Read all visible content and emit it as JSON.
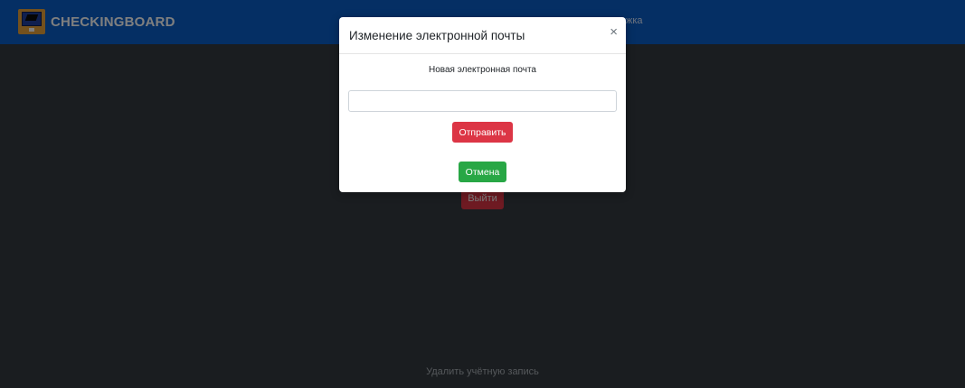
{
  "navbar": {
    "brand_name": "CHECKINGBOARD",
    "right_link_fragment": "жка",
    "background_color": "#0b5fc8"
  },
  "page": {
    "logout_label": "Выйти",
    "delete_account_label": "Удалить учётную запись"
  },
  "modal": {
    "title": "Изменение электронной почты",
    "close_glyph": "×",
    "field_label": "Новая электронная почта",
    "email_value": "",
    "send_label": "Отправить",
    "cancel_label": "Отмена"
  },
  "colors": {
    "danger": "#dc3545",
    "success": "#28a745",
    "background": "#343a40"
  },
  "icons": {
    "logo": "graduation-cap-monitor-icon",
    "close": "close-icon"
  }
}
